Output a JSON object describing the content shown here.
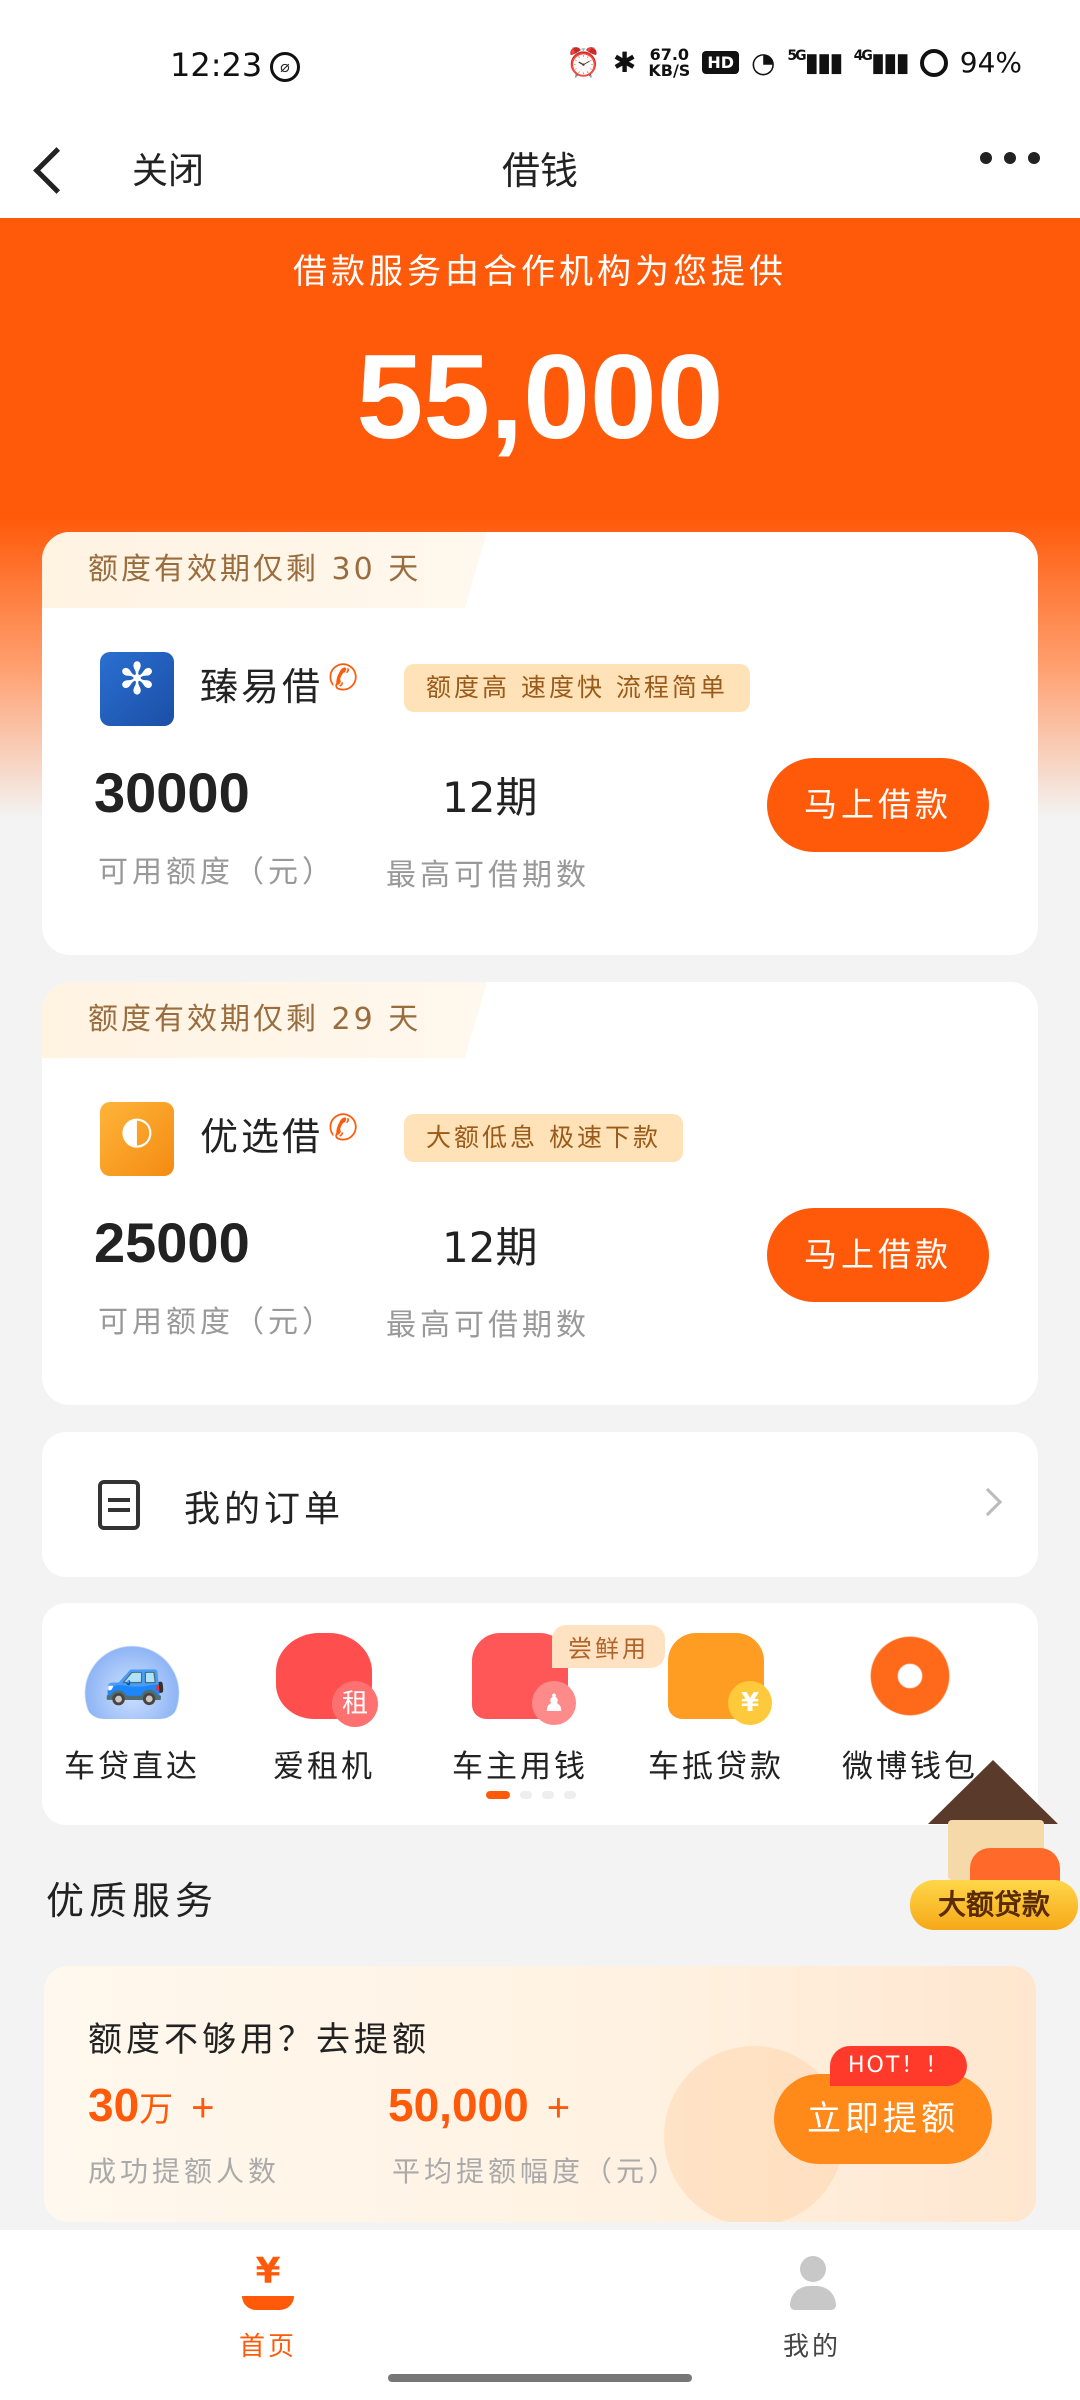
{
  "status_bar": {
    "time": "12:23",
    "net_speed": "67.0\nKB/S",
    "hd": "HD",
    "sig5g": "5G",
    "sig4g": "4G",
    "battery": "94%"
  },
  "nav": {
    "close": "关闭",
    "title": "借钱"
  },
  "hero": {
    "subtitle": "借款服务由合作机构为您提供",
    "amount": "55,000"
  },
  "loans": [
    {
      "expire": "额度有效期仅剩 30 天",
      "name": "臻易借",
      "tag": "额度高 速度快 流程简单",
      "amount": "30000",
      "amount_label": "可用额度（元）",
      "period": "12期",
      "period_label": "最高可借期数",
      "button": "马上借款"
    },
    {
      "expire": "额度有效期仅剩 29 天",
      "name": "优选借",
      "tag": "大额低息 极速下款",
      "amount": "25000",
      "amount_label": "可用额度（元）",
      "period": "12期",
      "period_label": "最高可借期数",
      "button": "马上借款"
    }
  ],
  "orders": {
    "label": "我的订单"
  },
  "services": {
    "badge": "尝鲜用",
    "items": [
      {
        "label": "车贷直达",
        "icon": "car-loan-icon"
      },
      {
        "label": "爱租机",
        "icon": "rent-phone-icon"
      },
      {
        "label": "车主用钱",
        "icon": "car-owner-icon"
      },
      {
        "label": "车抵贷款",
        "icon": "car-mortgage-icon"
      },
      {
        "label": "微博钱包",
        "icon": "weibo-wallet-icon"
      }
    ]
  },
  "float_ad": {
    "label": "大额贷款"
  },
  "quality": {
    "title": "优质服务",
    "promo": {
      "title": "额度不够用？去提额",
      "stat1_value": "30",
      "stat1_unit": "万",
      "stat1_plus": "+",
      "stat1_label": "成功提额人数",
      "stat2_value": "50,000",
      "stat2_plus": "+",
      "stat2_label": "平均提额幅度（元）",
      "hot": "HOT！！",
      "button": "立即提额"
    }
  },
  "tabbar": {
    "home": "首页",
    "me": "我的",
    "home_icon": "¥"
  },
  "colors": {
    "primary": "#ff5a0a",
    "tag_bg": "#ffe2b8",
    "hot": "#ff3a2a"
  }
}
